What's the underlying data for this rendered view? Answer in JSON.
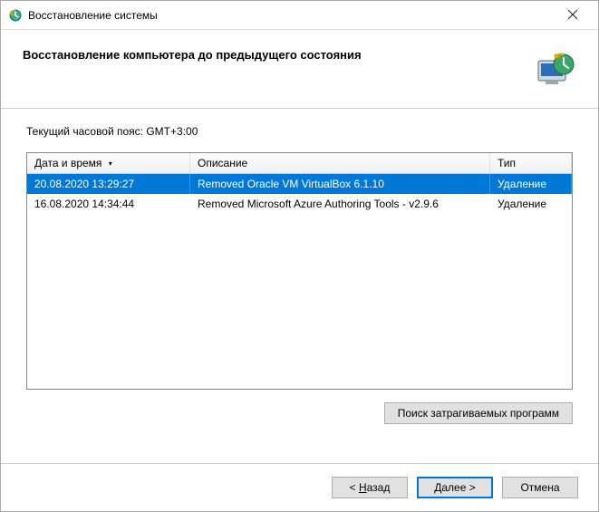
{
  "window": {
    "title": "Восстановление системы"
  },
  "header": {
    "heading": "Восстановление компьютера до предыдущего состояния"
  },
  "content": {
    "timezone_label": "Текущий часовой пояс: GMT+3:00"
  },
  "table": {
    "columns": {
      "date": "Дата и время",
      "desc": "Описание",
      "type": "Тип"
    },
    "rows": [
      {
        "date": "20.08.2020 13:29:27",
        "desc": "Removed Oracle VM VirtualBox 6.1.10",
        "type": "Удаление",
        "selected": true
      },
      {
        "date": "16.08.2020 14:34:44",
        "desc": "Removed Microsoft Azure Authoring Tools - v2.9.6",
        "type": "Удаление",
        "selected": false
      }
    ]
  },
  "buttons": {
    "scan": "Поиск затрагиваемых программ",
    "back_prefix": "< ",
    "back_u": "Н",
    "back_suffix": "азад",
    "next_u": "Д",
    "next_suffix": "алее >",
    "cancel": "Отмена"
  }
}
